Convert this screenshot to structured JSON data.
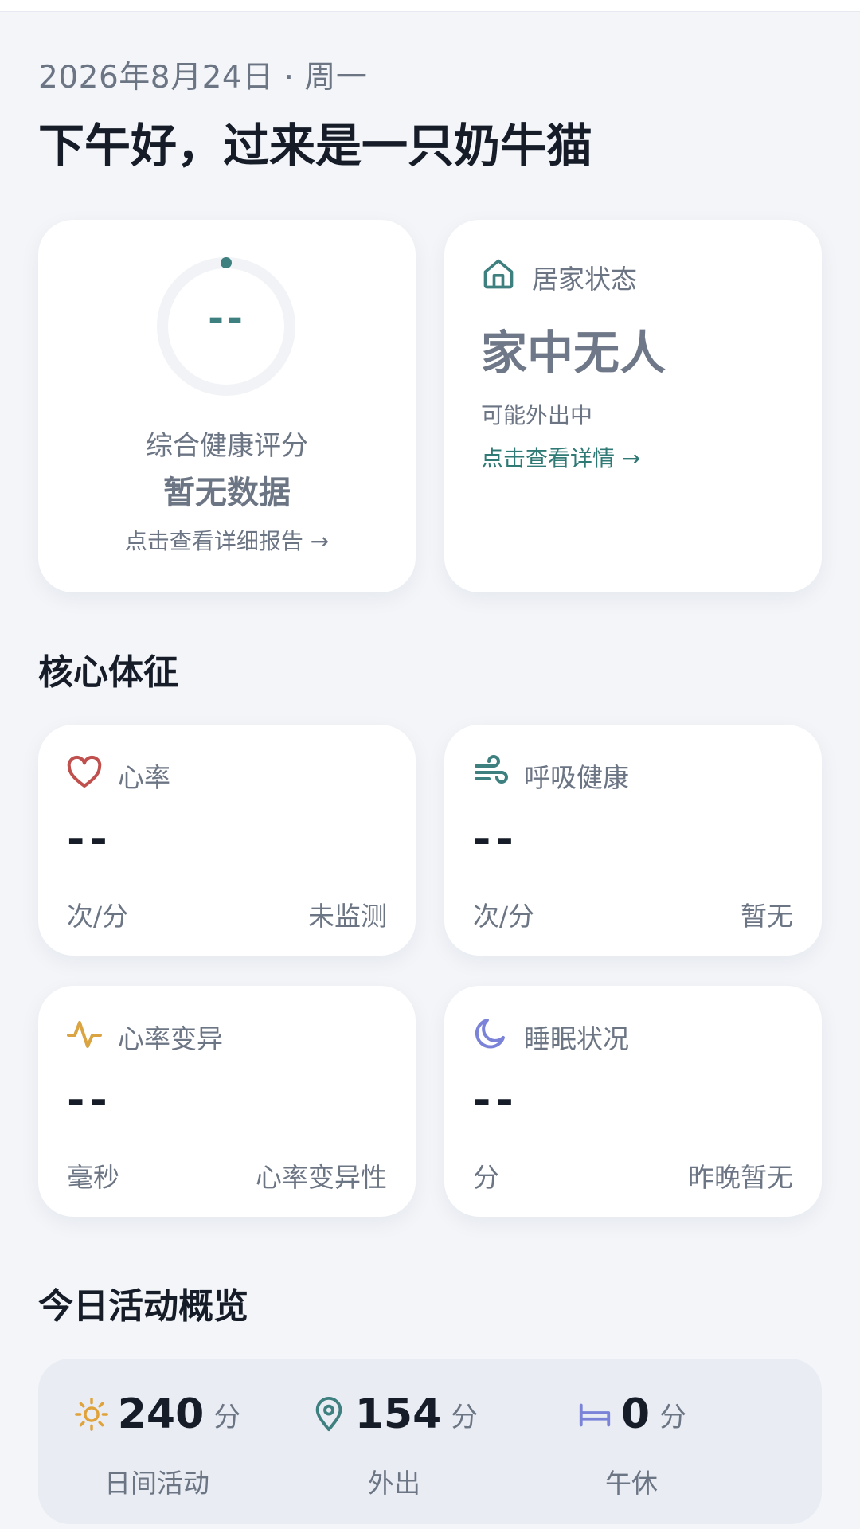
{
  "header": {
    "date": "2026年8月24日 · 周一",
    "greeting": "下午好，过来是一只奶牛猫"
  },
  "score_card": {
    "value": "--",
    "label": "综合健康评分",
    "status": "暂无数据",
    "link": "点击查看详细报告 →",
    "ring_color": "#3e7f80"
  },
  "home_card": {
    "icon": "home-icon",
    "label": "居家状态",
    "value": "家中无人",
    "sub": "可能外出中",
    "link": "点击查看详情 →"
  },
  "vitals": {
    "title": "核心体征",
    "items": [
      {
        "icon": "heart-icon",
        "label": "心率",
        "value": "--",
        "unit": "次/分",
        "status": "未监测",
        "color": "#c0504d"
      },
      {
        "icon": "wind-icon",
        "label": "呼吸健康",
        "value": "--",
        "unit": "次/分",
        "status": "暂无",
        "color": "#3e7f80"
      },
      {
        "icon": "pulse-icon",
        "label": "心率变异",
        "value": "--",
        "unit": "毫秒",
        "status": "心率变异性",
        "color": "#d9a441"
      },
      {
        "icon": "moon-icon",
        "label": "睡眠状况",
        "value": "--",
        "unit": "分",
        "status": "昨晚暂无",
        "color": "#7b83d8"
      }
    ]
  },
  "activity": {
    "title": "今日活动概览",
    "items": [
      {
        "icon": "sun-icon",
        "value": "240",
        "unit": "分",
        "label": "日间活动",
        "color": "#e0a23a"
      },
      {
        "icon": "location-pin-icon",
        "value": "154",
        "unit": "分",
        "label": "外出",
        "color": "#3e7f80"
      },
      {
        "icon": "bed-icon",
        "value": "0",
        "unit": "分",
        "label": "午休",
        "color": "#7b83d8"
      }
    ]
  }
}
